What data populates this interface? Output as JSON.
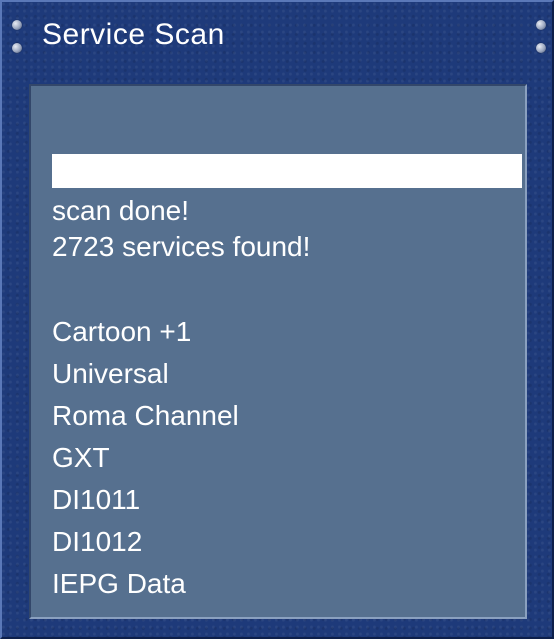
{
  "window": {
    "title": "Service Scan"
  },
  "scan": {
    "progress_percent": 100,
    "status": "scan done!",
    "summary": "2723 services found!"
  },
  "services": [
    "Cartoon +1",
    "Universal",
    "Roma Channel",
    "GXT",
    "DI1011",
    "DI1012",
    "IEPG Data"
  ],
  "colors": {
    "frame": "#1e3a7a",
    "panel": "#56708f",
    "text": "#ffffff",
    "progress_fill": "#ffffff"
  }
}
